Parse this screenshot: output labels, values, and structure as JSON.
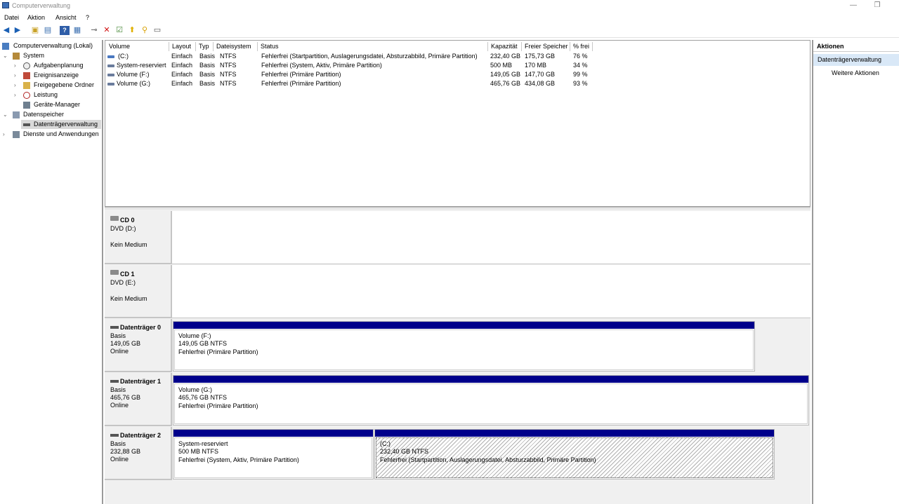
{
  "window": {
    "title": "Computerverwaltung",
    "minimize": "—",
    "restore": "❐"
  },
  "menu": [
    "Datei",
    "Aktion",
    "Ansicht",
    "?"
  ],
  "tree": [
    {
      "label": "Computerverwaltung (Lokal)",
      "icon": "computer-icon"
    },
    {
      "label": "System",
      "icon": "system-tools-icon"
    },
    {
      "label": "Aufgabenplanung",
      "icon": "clock-icon"
    },
    {
      "label": "Ereignisanzeige",
      "icon": "event-viewer-icon"
    },
    {
      "label": "Freigegebene Ordner",
      "icon": "shared-folder-icon"
    },
    {
      "label": "Leistung",
      "icon": "performance-icon"
    },
    {
      "label": "Geräte-Manager",
      "icon": "device-manager-icon"
    },
    {
      "label": "Datenspeicher",
      "icon": "storage-icon"
    },
    {
      "label": "Datenträgerverwaltung",
      "icon": "disk-management-icon"
    },
    {
      "label": "Dienste und Anwendungen",
      "icon": "services-icon"
    }
  ],
  "volume_table": {
    "columns": [
      "Volume",
      "Layout",
      "Typ",
      "Dateisystem",
      "Status",
      "Kapazität",
      "Freier Speicher",
      "% frei"
    ],
    "rows": [
      [
        "(C:)",
        "Einfach",
        "Basis",
        "NTFS",
        "Fehlerfrei (Startpartition, Auslagerungsdatei, Absturzabbild, Primäre Partition)",
        "232,40 GB",
        "175,73 GB",
        "76 %"
      ],
      [
        "System-reserviert",
        "Einfach",
        "Basis",
        "NTFS",
        "Fehlerfrei (System, Aktiv, Primäre Partition)",
        "500 MB",
        "170 MB",
        "34 %"
      ],
      [
        "Volume (F:)",
        "Einfach",
        "Basis",
        "NTFS",
        "Fehlerfrei (Primäre Partition)",
        "149,05 GB",
        "147,70 GB",
        "99 %"
      ],
      [
        "Volume (G:)",
        "Einfach",
        "Basis",
        "NTFS",
        "Fehlerfrei (Primäre Partition)",
        "465,76 GB",
        "434,08 GB",
        "93 %"
      ]
    ]
  },
  "disks": {
    "cd0": {
      "name": "CD 0",
      "type": "DVD (D:)",
      "media": "Kein Medium"
    },
    "cd1": {
      "name": "CD 1",
      "type": "DVD (E:)",
      "media": "Kein Medium"
    },
    "d0": {
      "name": "Datenträger 0",
      "kind": "Basis",
      "size": "149,05 GB",
      "state": "Online",
      "part1": {
        "name": "Volume  (F:)",
        "size": "149,05 GB NTFS",
        "status": "Fehlerfrei (Primäre Partition)"
      }
    },
    "d1": {
      "name": "Datenträger 1",
      "kind": "Basis",
      "size": "465,76 GB",
      "state": "Online",
      "part1": {
        "name": "Volume  (G:)",
        "size": "465,76 GB NTFS",
        "status": "Fehlerfrei (Primäre Partition)"
      }
    },
    "d2": {
      "name": "Datenträger 2",
      "kind": "Basis",
      "size": "232,88 GB",
      "state": "Online",
      "part1": {
        "name": "System-reserviert",
        "size": "500 MB NTFS",
        "status": "Fehlerfrei (System, Aktiv, Primäre Partition)"
      },
      "part2": {
        "name": "(C:)",
        "size": "232,40 GB NTFS",
        "status": "Fehlerfrei (Startpartition, Auslagerungsdatei, Absturzabbild, Primäre Partition)"
      }
    }
  },
  "actions": {
    "header": "Aktionen",
    "selected": "Datenträgerverwaltung",
    "more": "Weitere Aktionen"
  },
  "colors": {
    "partition_bar": "#00008b",
    "selection": "#d9e8f7"
  }
}
